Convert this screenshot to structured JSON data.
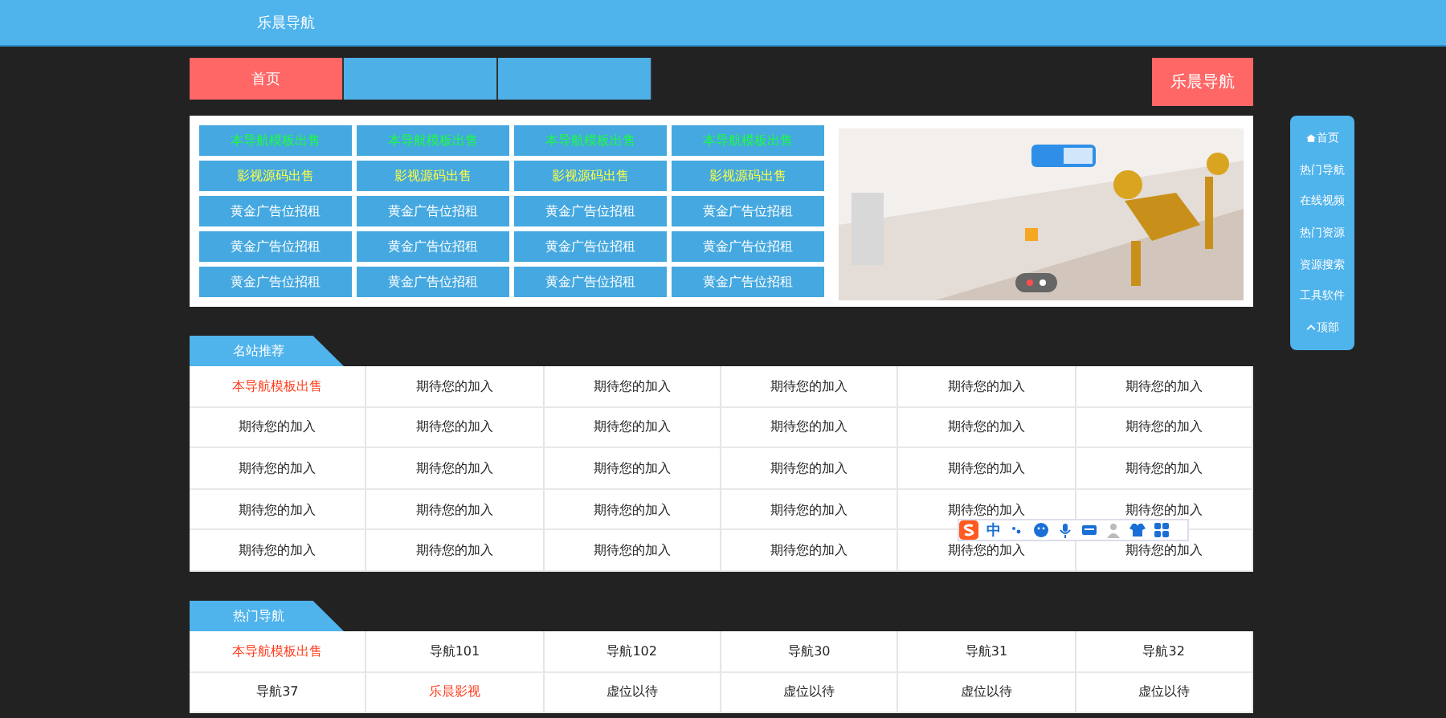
{
  "header": {
    "title": "乐晨导航"
  },
  "nav": {
    "items": [
      {
        "label": "首页",
        "selected": true
      },
      {
        "selected": false
      },
      {
        "selected": false
      }
    ],
    "brand_button": "乐晨导航"
  },
  "ad_grid": [
    {
      "kind": "green",
      "labels": [
        "本导航模板出售",
        "本导航模板出售",
        "本导航模板出售",
        "本导航模板出售"
      ]
    },
    {
      "kind": "yellow",
      "labels": [
        "影视源码出售",
        "影视源码出售",
        "影视源码出售",
        "影视源码出售"
      ]
    },
    {
      "kind": "white",
      "labels": [
        "黄金广告位招租",
        "黄金广告位招租",
        "黄金广告位招租",
        "黄金广告位招租"
      ]
    },
    {
      "kind": "white",
      "labels": [
        "黄金广告位招租",
        "黄金广告位招租",
        "黄金广告位招租",
        "黄金广告位招租"
      ]
    },
    {
      "kind": "white",
      "labels": [
        "黄金广告位招租",
        "黄金广告位招租",
        "黄金广告位招租",
        "黄金广告位招租"
      ]
    }
  ],
  "banner": {
    "kind": "picture",
    "dots": [
      {
        "selected": true
      },
      {
        "selected": false
      }
    ]
  },
  "side_menu": [
    {
      "label": "首页"
    },
    {
      "label": "热门导航"
    },
    {
      "label": "在线视频"
    },
    {
      "label": "热门资源"
    },
    {
      "label": "资源搜索"
    },
    {
      "label": "工具软件"
    },
    {
      "label": "顶部"
    }
  ],
  "sections": [
    {
      "title": "名站推荐",
      "rows": [
        [
          {
            "text": "本导航模板出售",
            "highlight": true
          },
          {
            "text": "期待您的加入",
            "highlight": false
          },
          {
            "text": "期待您的加入",
            "highlight": false
          },
          {
            "text": "期待您的加入",
            "highlight": false
          },
          {
            "text": "期待您的加入",
            "highlight": false
          },
          {
            "text": "期待您的加入",
            "highlight": false
          }
        ],
        [
          {
            "text": "期待您的加入",
            "highlight": false
          },
          {
            "text": "期待您的加入",
            "highlight": false
          },
          {
            "text": "期待您的加入",
            "highlight": false
          },
          {
            "text": "期待您的加入",
            "highlight": false
          },
          {
            "text": "期待您的加入",
            "highlight": false
          },
          {
            "text": "期待您的加入",
            "highlight": false
          }
        ],
        [
          {
            "text": "期待您的加入",
            "highlight": false
          },
          {
            "text": "期待您的加入",
            "highlight": false
          },
          {
            "text": "期待您的加入",
            "highlight": false
          },
          {
            "text": "期待您的加入",
            "highlight": false
          },
          {
            "text": "期待您的加入",
            "highlight": false
          },
          {
            "text": "期待您的加入",
            "highlight": false
          }
        ],
        [
          {
            "text": "期待您的加入",
            "highlight": false
          },
          {
            "text": "期待您的加入",
            "highlight": false
          },
          {
            "text": "期待您的加入",
            "highlight": false
          },
          {
            "text": "期待您的加入",
            "highlight": false
          },
          {
            "text": "期待您的加入",
            "highlight": false
          },
          {
            "text": "期待您的加入",
            "highlight": false
          }
        ],
        [
          {
            "text": "期待您的加入",
            "highlight": false
          },
          {
            "text": "期待您的加入",
            "highlight": false
          },
          {
            "text": "期待您的加入",
            "highlight": false
          },
          {
            "text": "期待您的加入",
            "highlight": false
          },
          {
            "text": "期待您的加入",
            "highlight": false
          },
          {
            "text": "期待您的加入",
            "highlight": false
          }
        ]
      ]
    },
    {
      "title": "热门导航",
      "rows": [
        [
          {
            "text": "本导航模板出售",
            "highlight": true
          },
          {
            "text": "导航101",
            "highlight": false
          },
          {
            "text": "导航102",
            "highlight": false
          },
          {
            "text": "导航30",
            "highlight": false
          },
          {
            "text": "导航31",
            "highlight": false
          },
          {
            "text": "导航32",
            "highlight": false
          }
        ],
        [
          {
            "text": "导航37",
            "highlight": false
          },
          {
            "text": "乐晨影视",
            "highlight": true
          },
          {
            "text": "虚位以待",
            "highlight": false
          },
          {
            "text": "虚位以待",
            "highlight": false
          },
          {
            "text": "虚位以待",
            "highlight": false
          },
          {
            "text": "虚位以待",
            "highlight": false
          }
        ]
      ]
    }
  ],
  "ime_toolbar": {
    "mode": "中"
  }
}
